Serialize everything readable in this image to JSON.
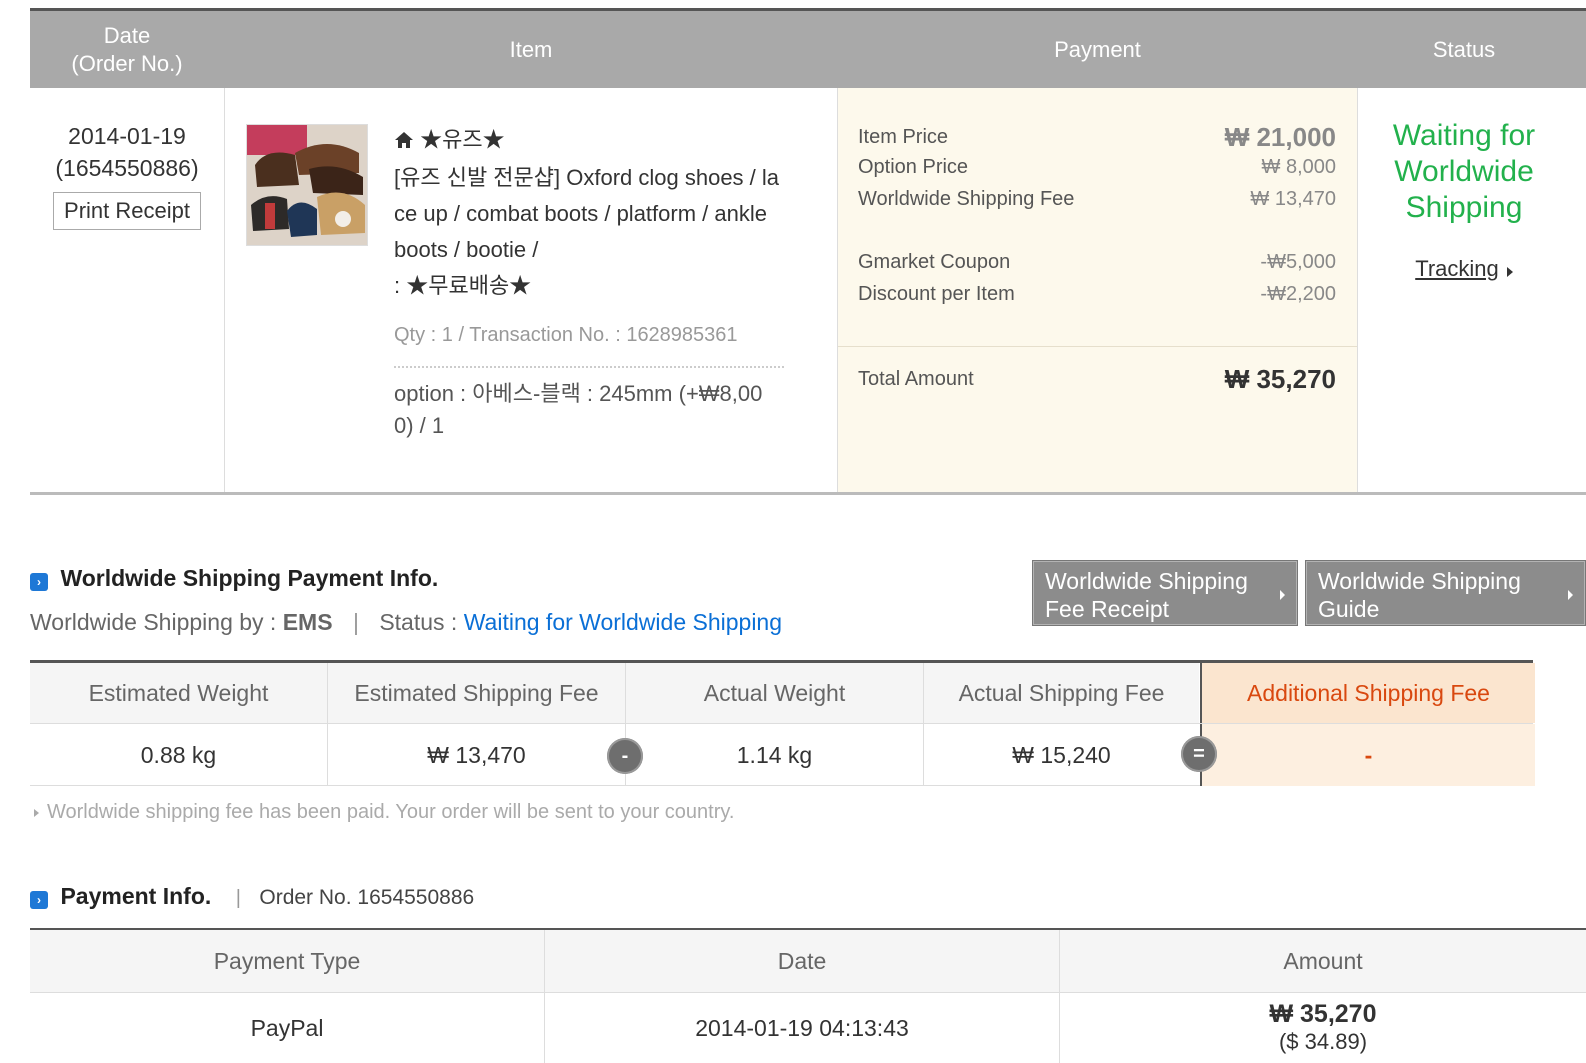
{
  "order_table": {
    "headers": {
      "date": "Date",
      "order_no": "(Order No.)",
      "item": "Item",
      "payment": "Payment",
      "status": "Status"
    },
    "date": "2014-01-19",
    "order_no": "(1654550886)",
    "print_receipt": "Print Receipt",
    "item": {
      "shop": "★유즈★",
      "title_lines": [
        "[유즈 신발 전문샵] Oxford clog shoes / la",
        "ce up / combat boots / platform / ankle",
        "boots / bootie /",
        ": ★무료배송★"
      ],
      "meta": "Qty : 1 / Transaction No. : 1628985361",
      "option_lines": [
        "option : 아베스-블랙 : 245mm (+₩8,00",
        "0) / 1"
      ]
    },
    "payment": {
      "item_price_label": "Item Price",
      "item_price": "₩ 21,000",
      "option_price_label": "Option Price",
      "option_price": "₩ 8,000",
      "ws_fee_label": "Worldwide Shipping Fee",
      "ws_fee": "₩ 13,470",
      "coupon_label": "Gmarket Coupon",
      "coupon": "-₩5,000",
      "discount_label": "Discount per Item",
      "discount": "-₩2,200",
      "total_label": "Total Amount",
      "total": "₩ 35,270"
    },
    "status": {
      "lines": [
        "Waiting for",
        "Worldwide",
        "Shipping"
      ],
      "tracking": "Tracking"
    }
  },
  "ws_section": {
    "title": "Worldwide Shipping Payment Info.",
    "by_label": "Worldwide Shipping by :",
    "by_value": "EMS",
    "sep": "|",
    "status_label": "Status :",
    "status_value": "Waiting for Worldwide Shipping",
    "btn_receipt": [
      "Worldwide Shipping",
      "Fee Receipt"
    ],
    "btn_guide": [
      "Worldwide Shipping",
      "Guide"
    ]
  },
  "ship_table": {
    "headers": [
      "Estimated Weight",
      "Estimated Shipping Fee",
      "Actual Weight",
      "Actual Shipping Fee",
      "Additional Shipping Fee"
    ],
    "values": [
      "0.88 kg",
      "₩ 13,470",
      "1.14 kg",
      "₩ 15,240",
      "-"
    ],
    "minus_symbol": "-",
    "equals_symbol": "="
  },
  "note": "Worldwide shipping fee has been paid. Your order will be sent to your country.",
  "payment_info": {
    "title": "Payment Info.",
    "sep": "|",
    "order_no": "Order No. 1654550886",
    "headers": [
      "Payment Type",
      "Date",
      "Amount"
    ],
    "type": "PayPal",
    "date": "2014-01-19 04:13:43",
    "amount": "₩ 35,270",
    "amount_usd": "($ 34.89)"
  },
  "colors": {
    "status_green": "#22b14c",
    "link_blue": "#0a6fd6",
    "additional_fee": "#d9480f",
    "header_gray": "#a9a9a9"
  }
}
